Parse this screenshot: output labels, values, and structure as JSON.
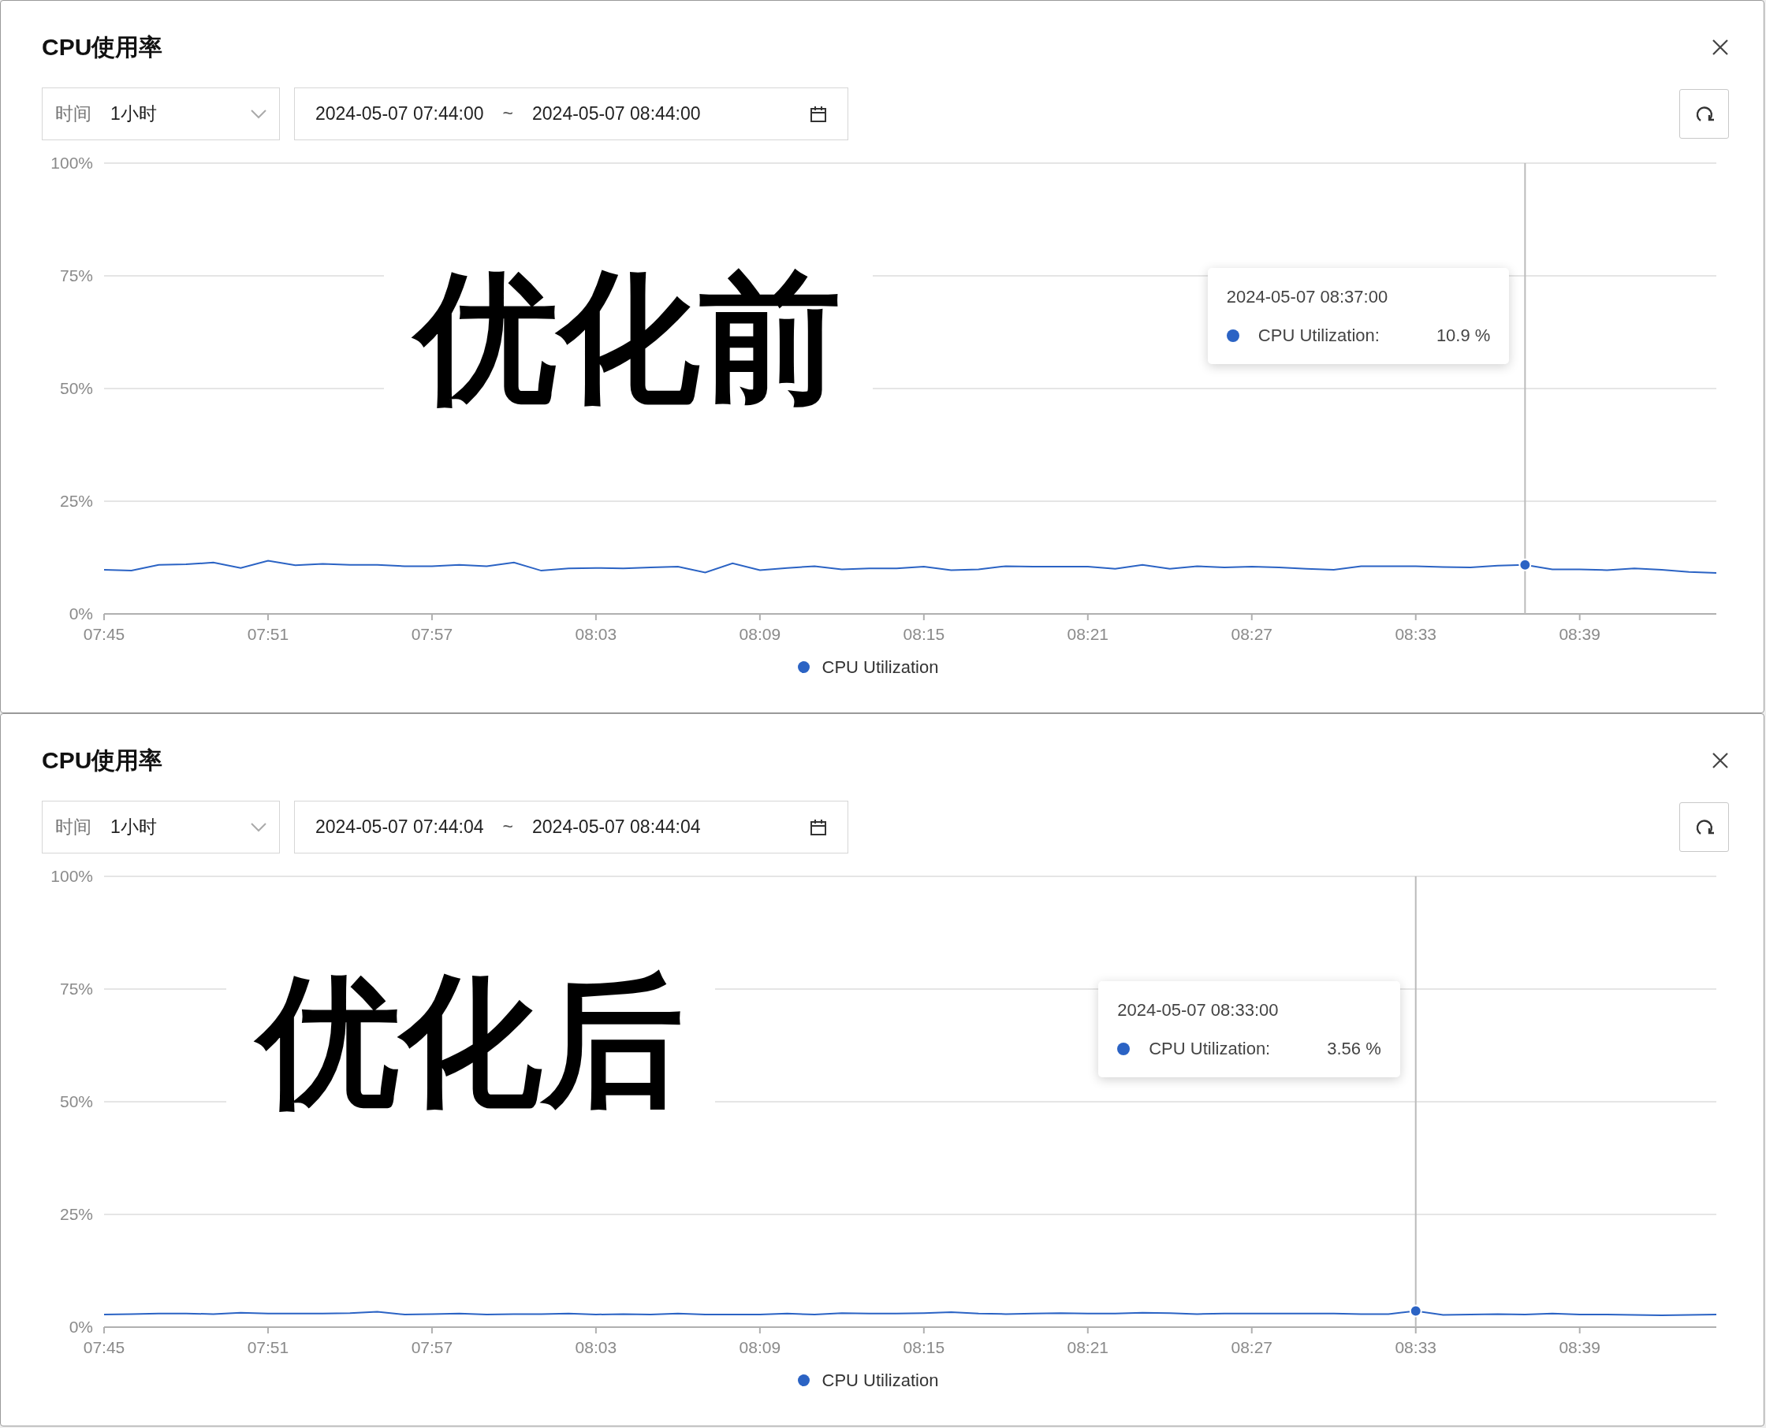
{
  "panels": [
    {
      "title": "CPU使用率",
      "time_select": {
        "label": "时间",
        "value": "1小时"
      },
      "date_range": {
        "start": "2024-05-07 07:44:00",
        "separator": "~",
        "end": "2024-05-07 08:44:00"
      },
      "overlay_label": "优化前",
      "tooltip": {
        "time": "2024-05-07 08:37:00",
        "series": "CPU Utilization:",
        "value": "10.9 %"
      },
      "chart_data": {
        "type": "line",
        "grid": true,
        "xlim": [
          465,
          524
        ],
        "ylim": [
          0,
          100
        ],
        "x": [
          465,
          466,
          467,
          468,
          469,
          470,
          471,
          472,
          473,
          474,
          475,
          476,
          477,
          478,
          479,
          480,
          481,
          482,
          483,
          484,
          485,
          486,
          487,
          488,
          489,
          490,
          491,
          492,
          493,
          494,
          495,
          496,
          497,
          498,
          499,
          500,
          501,
          502,
          503,
          504,
          505,
          506,
          507,
          508,
          509,
          510,
          511,
          512,
          513,
          514,
          515,
          516,
          517,
          518,
          519,
          520,
          521,
          522,
          523,
          524
        ],
        "xticks": [
          {
            "value": 465,
            "label": "07:45"
          },
          {
            "value": 471,
            "label": "07:51"
          },
          {
            "value": 477,
            "label": "07:57"
          },
          {
            "value": 483,
            "label": "08:03"
          },
          {
            "value": 489,
            "label": "08:09"
          },
          {
            "value": 495,
            "label": "08:15"
          },
          {
            "value": 501,
            "label": "08:21"
          },
          {
            "value": 507,
            "label": "08:27"
          },
          {
            "value": 513,
            "label": "08:33"
          },
          {
            "value": 519,
            "label": "08:39"
          }
        ],
        "yticks": [
          {
            "value": 0,
            "label": "0%"
          },
          {
            "value": 25,
            "label": "25%"
          },
          {
            "value": 50,
            "label": "50%"
          },
          {
            "value": 75,
            "label": "75%"
          },
          {
            "value": 100,
            "label": "100%"
          }
        ],
        "series": [
          {
            "name": "CPU Utilization",
            "color": "#2b63c4",
            "values": [
              9.8,
              9.6,
              10.9,
              11,
              11.4,
              10.2,
              11.8,
              10.8,
              11.1,
              10.9,
              10.9,
              10.6,
              10.6,
              10.9,
              10.6,
              11.4,
              9.6,
              10.1,
              10.2,
              10.1,
              10.3,
              10.5,
              9.2,
              11.2,
              9.7,
              10.2,
              10.6,
              9.9,
              10.1,
              10.1,
              10.5,
              9.7,
              9.9,
              10.6,
              10.5,
              10.5,
              10.5,
              10.0,
              10.9,
              10.0,
              10.6,
              10.3,
              10.5,
              10.3,
              10.0,
              9.8,
              10.6,
              10.6,
              10.6,
              10.4,
              10.3,
              10.7,
              10.9,
              9.9,
              9.9,
              9.7,
              10.1,
              9.8,
              9.3,
              9.1
            ]
          }
        ],
        "ref_lines": [
          {
            "axis": "x",
            "value": 517
          }
        ]
      }
    },
    {
      "title": "CPU使用率",
      "time_select": {
        "label": "时间",
        "value": "1小时"
      },
      "date_range": {
        "start": "2024-05-07 07:44:04",
        "separator": "~",
        "end": "2024-05-07 08:44:04"
      },
      "overlay_label": "优化后",
      "tooltip": {
        "time": "2024-05-07 08:33:00",
        "series": "CPU Utilization:",
        "value": "3.56 %"
      },
      "chart_data": {
        "type": "line",
        "grid": true,
        "xlim": [
          465,
          524
        ],
        "ylim": [
          0,
          100
        ],
        "x": [
          465,
          466,
          467,
          468,
          469,
          470,
          471,
          472,
          473,
          474,
          475,
          476,
          477,
          478,
          479,
          480,
          481,
          482,
          483,
          484,
          485,
          486,
          487,
          488,
          489,
          490,
          491,
          492,
          493,
          494,
          495,
          496,
          497,
          498,
          499,
          500,
          501,
          502,
          503,
          504,
          505,
          506,
          507,
          508,
          509,
          510,
          511,
          512,
          513,
          514,
          515,
          516,
          517,
          518,
          519,
          520,
          521,
          522,
          523,
          524
        ],
        "xticks": [
          {
            "value": 465,
            "label": "07:45"
          },
          {
            "value": 471,
            "label": "07:51"
          },
          {
            "value": 477,
            "label": "07:57"
          },
          {
            "value": 483,
            "label": "08:03"
          },
          {
            "value": 489,
            "label": "08:09"
          },
          {
            "value": 495,
            "label": "08:15"
          },
          {
            "value": 501,
            "label": "08:21"
          },
          {
            "value": 507,
            "label": "08:27"
          },
          {
            "value": 513,
            "label": "08:33"
          },
          {
            "value": 519,
            "label": "08:39"
          }
        ],
        "yticks": [
          {
            "value": 0,
            "label": "0%"
          },
          {
            "value": 25,
            "label": "25%"
          },
          {
            "value": 50,
            "label": "50%"
          },
          {
            "value": 75,
            "label": "75%"
          },
          {
            "value": 100,
            "label": "100%"
          }
        ],
        "series": [
          {
            "name": "CPU Utilization",
            "color": "#2b63c4",
            "values": [
              2.8,
              2.9,
              3.0,
              3.0,
              2.9,
              3.2,
              3.0,
              3.0,
              3.0,
              3.1,
              3.4,
              2.8,
              2.9,
              3.0,
              2.8,
              2.9,
              2.9,
              3.0,
              2.8,
              2.9,
              2.8,
              3.0,
              2.8,
              2.8,
              2.8,
              3.0,
              2.8,
              3.1,
              3.0,
              3.0,
              3.1,
              3.3,
              3.0,
              2.9,
              3.0,
              3.1,
              3.0,
              3.0,
              3.2,
              3.1,
              2.9,
              3.0,
              3.0,
              3.0,
              3.0,
              3.0,
              2.9,
              2.9,
              3.6,
              2.7,
              2.8,
              2.9,
              2.8,
              3.0,
              2.8,
              2.8,
              2.7,
              2.6,
              2.7,
              2.8
            ]
          }
        ],
        "ref_lines": [
          {
            "axis": "x",
            "value": 513
          }
        ]
      }
    }
  ]
}
